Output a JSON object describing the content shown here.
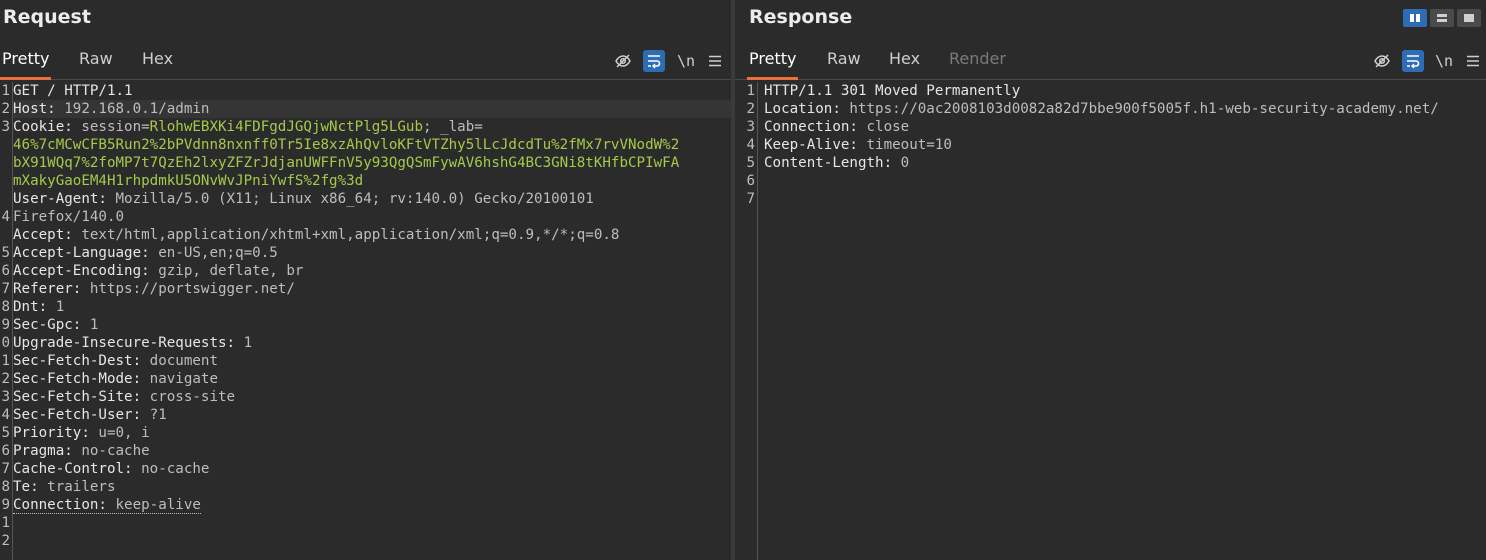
{
  "request": {
    "title": "Request",
    "tabs": [
      {
        "label": "Pretty",
        "active": true
      },
      {
        "label": "Raw",
        "active": false
      },
      {
        "label": "Hex",
        "active": false
      }
    ],
    "line_numbers": [
      "1",
      "2",
      "3",
      "",
      "",
      "",
      "",
      "4",
      "",
      "5",
      "6",
      "7",
      "8",
      "9",
      "0",
      "1",
      "2",
      "3",
      "4",
      "5",
      "6",
      "7",
      "8",
      "9",
      "1",
      "2"
    ],
    "lines": [
      {
        "key": "GET / HTTP/1.1",
        "val": ""
      },
      {
        "key": "Host:",
        "val": " 192.168.0.1/admin"
      },
      {
        "key": "Cookie:",
        "val": " session=",
        "green": "RlohwEBXKi4FDFgdJGQjwNctPlg5LGub",
        "tail": "; _lab="
      },
      {
        "key": "",
        "val": "",
        "green": "46%7cMCwCFB5Run2%2bPVdnn8nxnff0Tr5Ie8xzAhQvloKFtVTZhy5lLcJdcdTu%2fMx7rvVNodW%2"
      },
      {
        "key": "",
        "val": "",
        "green": "bX91WQq7%2foMP7t7QzEh2lxyZFZrJdjanUWFFnV5y93QgQSmFywAV6hshG4BC3GNi8tKHfbCPIwFA"
      },
      {
        "key": "",
        "val": "",
        "green": "mXakyGaoEM4H1rhpdmkU5ONvWvJPniYwfS%2fg%3d"
      },
      {
        "key": "User-Agent:",
        "val": " Mozilla/5.0 (X11; Linux x86_64; rv:140.0) Gecko/20100101"
      },
      {
        "key": "",
        "val": "Firefox/140.0"
      },
      {
        "key": "Accept:",
        "val": " text/html,application/xhtml+xml,application/xml;q=0.9,*/*;q=0.8"
      },
      {
        "key": "Accept-Language:",
        "val": " en-US,en;q=0.5"
      },
      {
        "key": "Accept-Encoding:",
        "val": " gzip, deflate, br"
      },
      {
        "key": "Referer:",
        "val": " https://portswigger.net/"
      },
      {
        "key": "Dnt:",
        "val": " 1"
      },
      {
        "key": "Sec-Gpc:",
        "val": " 1"
      },
      {
        "key": "Upgrade-Insecure-Requests:",
        "val": " 1"
      },
      {
        "key": "Sec-Fetch-Dest:",
        "val": " document"
      },
      {
        "key": "Sec-Fetch-Mode:",
        "val": " navigate"
      },
      {
        "key": "Sec-Fetch-Site:",
        "val": " cross-site"
      },
      {
        "key": "Sec-Fetch-User:",
        "val": " ?1"
      },
      {
        "key": "Priority:",
        "val": " u=0, i"
      },
      {
        "key": "Pragma:",
        "val": " no-cache"
      },
      {
        "key": "Cache-Control:",
        "val": " no-cache"
      },
      {
        "key": "Te:",
        "val": " trailers"
      },
      {
        "key": "Connection:",
        "val": " keep-alive"
      },
      {
        "key": "",
        "val": ""
      },
      {
        "key": "",
        "val": ""
      }
    ]
  },
  "response": {
    "title": "Response",
    "tabs": [
      {
        "label": "Pretty",
        "active": true
      },
      {
        "label": "Raw",
        "active": false
      },
      {
        "label": "Hex",
        "active": false
      },
      {
        "label": "Render",
        "active": false
      }
    ],
    "line_numbers": [
      "1",
      "2",
      "3",
      "4",
      "5",
      "6",
      "7"
    ],
    "lines": [
      {
        "key": "HTTP/1.1 301 Moved Permanently",
        "val": ""
      },
      {
        "key": "Location:",
        "val": " https://0ac2008103d0082a82d7bbe900f5005f.h1-web-security-academy.net/"
      },
      {
        "key": "Connection:",
        "val": " close"
      },
      {
        "key": "Keep-Alive:",
        "val": " timeout=10"
      },
      {
        "key": "Content-Length:",
        "val": " 0"
      },
      {
        "key": "",
        "val": ""
      },
      {
        "key": "",
        "val": ""
      }
    ]
  },
  "toolbar": {
    "newline_label": "\\n",
    "icons": [
      "eye-off-icon",
      "wrap-icon",
      "newline-icon",
      "menu-icon"
    ]
  },
  "colors": {
    "accent": "#e8703a",
    "toggle_on": "#2e6db4",
    "cookie_value": "#a7c94a"
  }
}
